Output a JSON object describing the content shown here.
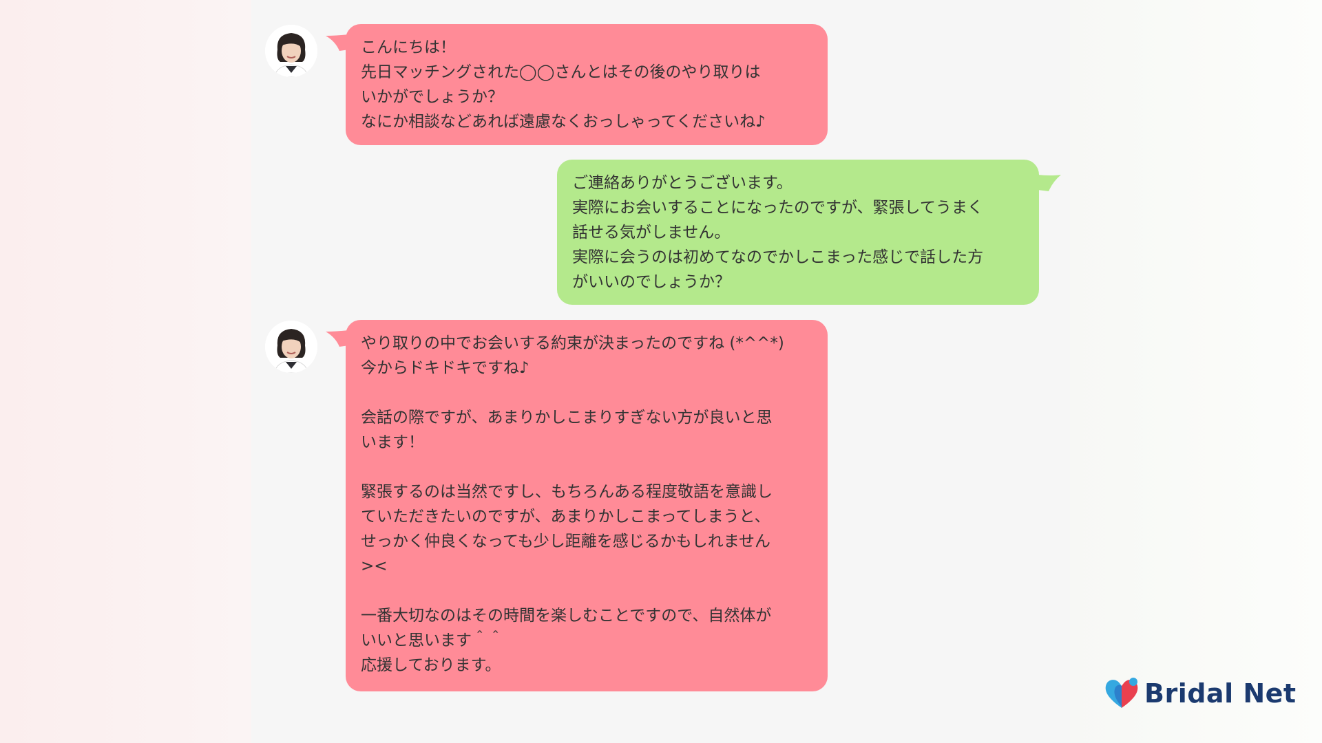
{
  "messages": [
    {
      "sender": "advisor",
      "text": "こんにちは！\n先日マッチングされた◯◯さんとはその後のやり取りは\nいかがでしょうか？\nなにか相談などあれば遠慮なくおっしゃってくださいね♪"
    },
    {
      "sender": "user",
      "text": "ご連絡ありがとうございます。\n実際にお会いすることになったのですが、緊張してうまく\n話せる気がしません。\n実際に会うのは初めてなのでかしこまった感じで話した方\nがいいのでしょうか？"
    },
    {
      "sender": "advisor",
      "text": "やり取りの中でお会いする約束が決まったのですね (*^^*)\n今からドキドキですね♪\n\n会話の際ですが、あまりかしこまりすぎない方が良いと思\nいます！\n\n緊張するのは当然ですし、もちろんある程度敬語を意識し\nていただきたいのですが、あまりかしこまってしまうと、\nせっかく仲良くなっても少し距離を感じるかもしれません\n><\n\n一番大切なのはその時間を楽しむことですので、自然体が\nいいと思います＾＾\n応援しております。"
    }
  ],
  "brand": {
    "name": "Bridal Net"
  },
  "colors": {
    "advisor_bubble": "#ff8b97",
    "user_bubble": "#b4e98c",
    "brand_navy": "#1b3a6f",
    "brand_blue": "#35a8e0",
    "brand_red": "#e9404f"
  },
  "icons": {
    "avatar": "advisor-avatar",
    "logo": "heart-logo-icon"
  }
}
